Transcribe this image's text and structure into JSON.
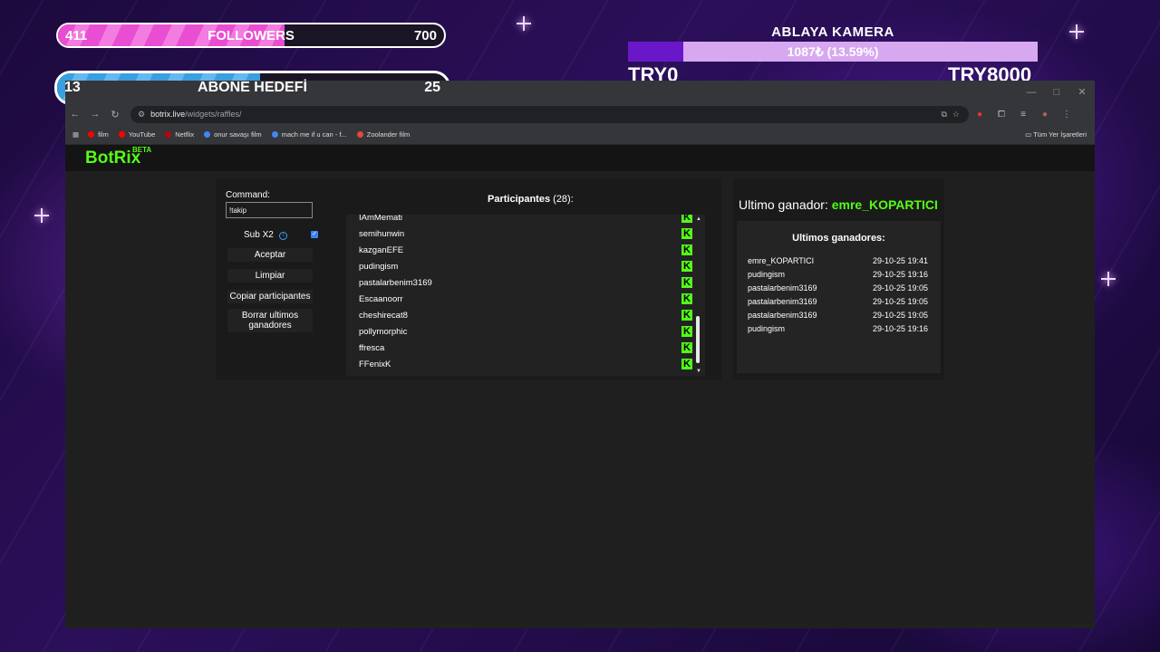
{
  "overlay": {
    "followers": {
      "current": "411",
      "label": "FOLLOWERS",
      "goal": "700",
      "progress": 0.587
    },
    "abone": {
      "current": "13",
      "label": "ABONE HEDEFİ",
      "goal": "25",
      "progress": 0.52
    },
    "kamera": {
      "title": "ABLAYA KAMERA",
      "progress_text": "1087₺ (13.59%)",
      "progress": 0.1359,
      "left": "TRY0",
      "right": "TRY8000"
    }
  },
  "browser": {
    "url_host": "botrix.live",
    "url_path": "/widgets/raffles/",
    "bookmarks": [
      {
        "label": "film",
        "color": "#ff0000"
      },
      {
        "label": "YouTube",
        "color": "#ff0000"
      },
      {
        "label": "Netflix",
        "color": "#b20710"
      },
      {
        "label": "onur savaşı film",
        "color": "#4285f4"
      },
      {
        "label": "mach me if u can - f...",
        "color": "#4285f4"
      },
      {
        "label": "Zoolander film",
        "color": "#e8453c"
      }
    ],
    "all_bookmarks": "Tüm Yer İşaretleri"
  },
  "app": {
    "logo": "BotRix",
    "beta": "BETA"
  },
  "raffle": {
    "command_label": "Command:",
    "command_value": "!takip",
    "sub_label": "Sub X2",
    "sub_checked": true,
    "buttons": {
      "accept": "Aceptar",
      "clear": "Limpiar",
      "copy": "Copiar participantes",
      "delete": "Borrar ultimos ganadores"
    },
    "participants_label": "Participantes",
    "participants_count": "(28):",
    "participants": [
      "IAmMemati",
      "semihunwin",
      "kazganEFE",
      "pudingism",
      "pastalarbenim3169",
      "Escaanoorr",
      "cheshirecat8",
      "pollymorphic",
      "ffresca",
      "FFenixK"
    ]
  },
  "winners": {
    "last_label": "Ultimo ganador:",
    "last_name": "emre_KOPARTICI",
    "list_title": "Ultimos ganadores:",
    "list": [
      {
        "name": "emre_KOPARTICI",
        "time": "29-10-25 19:41"
      },
      {
        "name": "pudingism",
        "time": "29-10-25 19:16"
      },
      {
        "name": "pastalarbenim3169",
        "time": "29-10-25 19:05"
      },
      {
        "name": "pastalarbenim3169",
        "time": "29-10-25 19:05"
      },
      {
        "name": "pastalarbenim3169",
        "time": "29-10-25 19:05"
      },
      {
        "name": "pudingism",
        "time": "29-10-25 19:16"
      }
    ]
  }
}
